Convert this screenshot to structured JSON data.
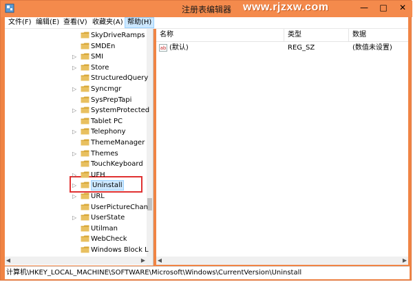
{
  "window": {
    "title": "注册表编辑器",
    "watermark": "www.rjzxw.com",
    "minimize_label": "—",
    "maximize_label": "□",
    "close_label": "✕"
  },
  "menu": {
    "items": [
      {
        "label": "文件(F)"
      },
      {
        "label": "编辑(E)"
      },
      {
        "label": "查看(V)"
      },
      {
        "label": "收藏夹(A)"
      },
      {
        "label": "帮助(H)"
      }
    ]
  },
  "tree": {
    "items": [
      {
        "label": "SkyDriveRamps",
        "expandable": false
      },
      {
        "label": "SMDEn",
        "expandable": false
      },
      {
        "label": "SMI",
        "expandable": true
      },
      {
        "label": "Store",
        "expandable": true
      },
      {
        "label": "StructuredQuery",
        "expandable": false
      },
      {
        "label": "Syncmgr",
        "expandable": true
      },
      {
        "label": "SysPrepTapi",
        "expandable": false
      },
      {
        "label": "SystemProtected",
        "expandable": true
      },
      {
        "label": "Tablet PC",
        "expandable": false
      },
      {
        "label": "Telephony",
        "expandable": true
      },
      {
        "label": "ThemeManager",
        "expandable": false
      },
      {
        "label": "Themes",
        "expandable": true
      },
      {
        "label": "TouchKeyboard",
        "expandable": false
      },
      {
        "label": "UFH",
        "expandable": true
      },
      {
        "label": "Uninstall",
        "expandable": true,
        "selected": true
      },
      {
        "label": "URL",
        "expandable": true
      },
      {
        "label": "UserPictureChan",
        "expandable": false
      },
      {
        "label": "UserState",
        "expandable": true
      },
      {
        "label": "Utilman",
        "expandable": false
      },
      {
        "label": "WebCheck",
        "expandable": false
      },
      {
        "label": "Windows Block L",
        "expandable": false
      }
    ]
  },
  "list": {
    "columns": {
      "name": "名称",
      "type": "类型",
      "data": "数据"
    },
    "rows": [
      {
        "name": "(默认)",
        "type": "REG_SZ",
        "data": "(数值未设置)",
        "icon": "ab-icon"
      }
    ]
  },
  "status": {
    "path": "计算机\\HKEY_LOCAL_MACHINE\\SOFTWARE\\Microsoft\\Windows\\CurrentVersion\\Uninstall"
  },
  "colors": {
    "titlebar": "#f48a4c",
    "selection": "#cce8ff",
    "highlight_box": "#e03030",
    "folder": "#e8c060"
  }
}
